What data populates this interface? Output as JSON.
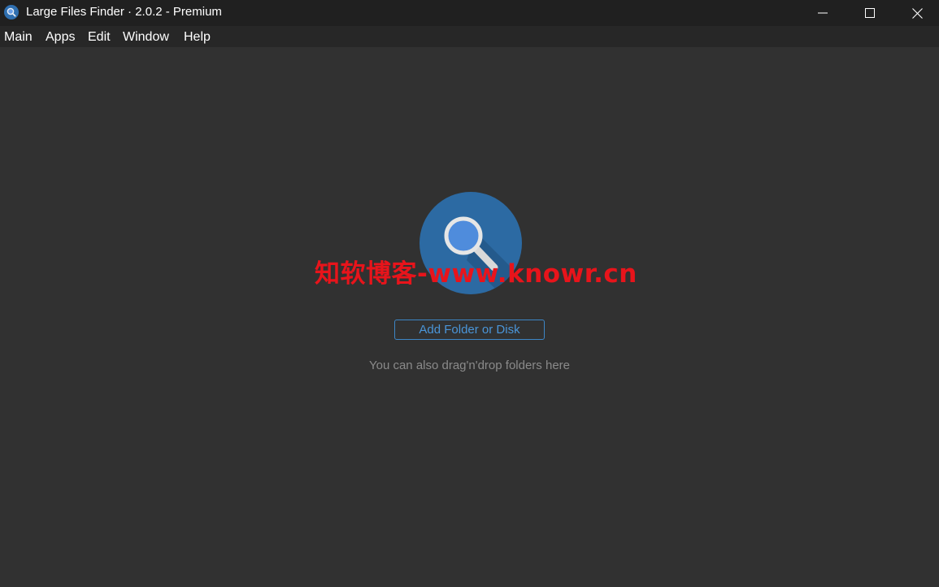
{
  "window": {
    "title": "Large Files Finder · 2.0.2 - Premium",
    "controls": [
      "minimize",
      "maximize",
      "close"
    ]
  },
  "menu": {
    "items": [
      {
        "label": "Main"
      },
      {
        "label": "Apps"
      },
      {
        "label": "Edit"
      },
      {
        "label": "Window"
      },
      {
        "label": "Help"
      }
    ]
  },
  "main": {
    "hero_icon": "magnifier-icon",
    "watermark": "知软博客-www.knowr.cn",
    "add_button_label": "Add Folder or Disk",
    "hint": "You can also drag'n'drop folders here"
  },
  "colors": {
    "background": "#313131",
    "titlebar": "#202020",
    "menubar": "#272727",
    "accent": "#4a95d8",
    "icon_circle": "#2c6aa3",
    "watermark": "#e8141b"
  }
}
